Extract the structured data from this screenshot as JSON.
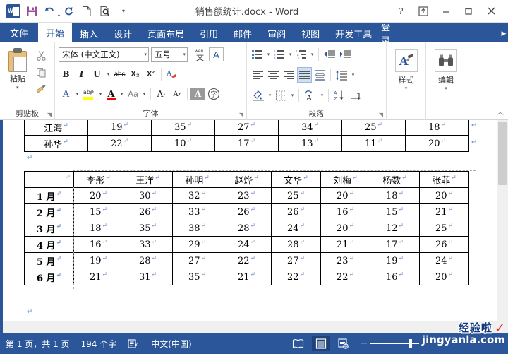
{
  "titlebar": {
    "document_title": "销售额统计.docx - Word",
    "quick_access": [
      {
        "name": "word-logo-icon",
        "label": "W"
      },
      {
        "name": "save-icon",
        "label": "Save"
      },
      {
        "name": "undo-icon",
        "label": "Undo"
      },
      {
        "name": "redo-icon",
        "label": "Redo"
      },
      {
        "name": "new-document-icon",
        "label": "New"
      },
      {
        "name": "print-preview-icon",
        "label": "Print Preview"
      },
      {
        "name": "customize-qat-icon",
        "label": "Customize"
      }
    ],
    "help_label": "?",
    "ribbon_display_label": "Ribbon Display Options",
    "minimize_label": "—",
    "restore_label": "❐",
    "close_label": "✕"
  },
  "tabs": {
    "file_label": "文件",
    "items": [
      {
        "label": "开始",
        "active": true
      },
      {
        "label": "插入",
        "active": false
      },
      {
        "label": "设计",
        "active": false
      },
      {
        "label": "页面布局",
        "active": false
      },
      {
        "label": "引用",
        "active": false
      },
      {
        "label": "邮件",
        "active": false
      },
      {
        "label": "审阅",
        "active": false
      },
      {
        "label": "视图",
        "active": false
      },
      {
        "label": "开发工具",
        "active": false
      },
      {
        "label": "登录",
        "active": false
      }
    ]
  },
  "ribbon": {
    "clipboard": {
      "group_label": "剪贴板",
      "paste_label": "粘贴",
      "cut_label": "剪切",
      "copy_label": "复制",
      "format_painter_label": "格式刷"
    },
    "font": {
      "group_label": "字体",
      "font_name": "宋体 (中文正文)",
      "font_size": "五号",
      "phonetic_label": "拼音指南",
      "enclose_label": "字符边框",
      "bold_label": "B",
      "italic_label": "I",
      "underline_label": "U",
      "strikethrough_label": "abc",
      "subscript_label": "X₂",
      "superscript_label": "X²",
      "clear_format_label": "清除格式",
      "text_effects_label": "A",
      "highlight_label": "文本突出显示颜色",
      "font_color_label": "A",
      "change_case_label": "Aa",
      "grow_font_label": "A",
      "shrink_font_label": "A",
      "char_shading_label": "A",
      "char_border_label": "字"
    },
    "paragraph": {
      "group_label": "段落",
      "bullets_label": "项目符号",
      "numbering_label": "编号",
      "multilevel_label": "多级列表",
      "decrease_indent_label": "减少缩进量",
      "increase_indent_label": "增加缩进量",
      "align_left_label": "左对齐",
      "align_center_label": "居中",
      "align_right_label": "右对齐",
      "justify_label": "两端对齐",
      "distributed_label": "分散对齐",
      "line_spacing_label": "行和段落间距",
      "shading_label": "底纹",
      "borders_label": "边框",
      "asian_layout_label": "中文版式",
      "sort_label": "排序",
      "show_marks_label": "显示编辑标记"
    },
    "styles": {
      "group_label": "样式",
      "button_label": "样式"
    },
    "editing": {
      "group_label": "编辑",
      "button_label": "编辑"
    },
    "collapse_label": "︿"
  },
  "document": {
    "top_table": {
      "rows": [
        {
          "name": "江海",
          "values": [
            "19",
            "35",
            "27",
            "34",
            "25",
            "18"
          ]
        },
        {
          "name": "孙华",
          "values": [
            "22",
            "10",
            "17",
            "13",
            "11",
            "20"
          ]
        }
      ]
    },
    "main_table": {
      "corner_label": "",
      "columns": [
        "李彤",
        "王洋",
        "孙明",
        "赵烨",
        "文华",
        "刘梅",
        "杨数",
        "张菲"
      ],
      "rows": [
        {
          "month": "1 月",
          "values": [
            "20",
            "30",
            "32",
            "23",
            "25",
            "20",
            "18",
            "20"
          ]
        },
        {
          "month": "2 月",
          "values": [
            "15",
            "26",
            "33",
            "26",
            "26",
            "16",
            "15",
            "21"
          ]
        },
        {
          "month": "3 月",
          "values": [
            "18",
            "35",
            "38",
            "28",
            "24",
            "20",
            "12",
            "25"
          ]
        },
        {
          "month": "4 月",
          "values": [
            "16",
            "33",
            "29",
            "24",
            "28",
            "21",
            "17",
            "26"
          ]
        },
        {
          "month": "5 月",
          "values": [
            "19",
            "28",
            "27",
            "22",
            "27",
            "23",
            "19",
            "24"
          ]
        },
        {
          "month": "6 月",
          "values": [
            "21",
            "31",
            "35",
            "21",
            "22",
            "22",
            "16",
            "20"
          ]
        }
      ]
    },
    "pilcrow": "↵"
  },
  "statusbar": {
    "page_info": "第 1 页，共 1 页",
    "word_count": "194 个字",
    "proofing_label": "校对",
    "language": "中文(中国)",
    "view_read_label": "阅读视图",
    "view_print_label": "页面视图",
    "view_web_label": "Web 版式视图",
    "zoom_out_label": "−",
    "zoom_in_label": "+"
  },
  "watermark": {
    "cn_text": "经验啦",
    "check_mark": "✓",
    "url_text": "jingyanla.com"
  },
  "colors": {
    "word_blue": "#2b579a",
    "accent_selected": "#cfe0f4",
    "highlight_yellow": "#ffff00",
    "font_color_red": "#ff0000",
    "watermark_red": "#e8231f"
  }
}
